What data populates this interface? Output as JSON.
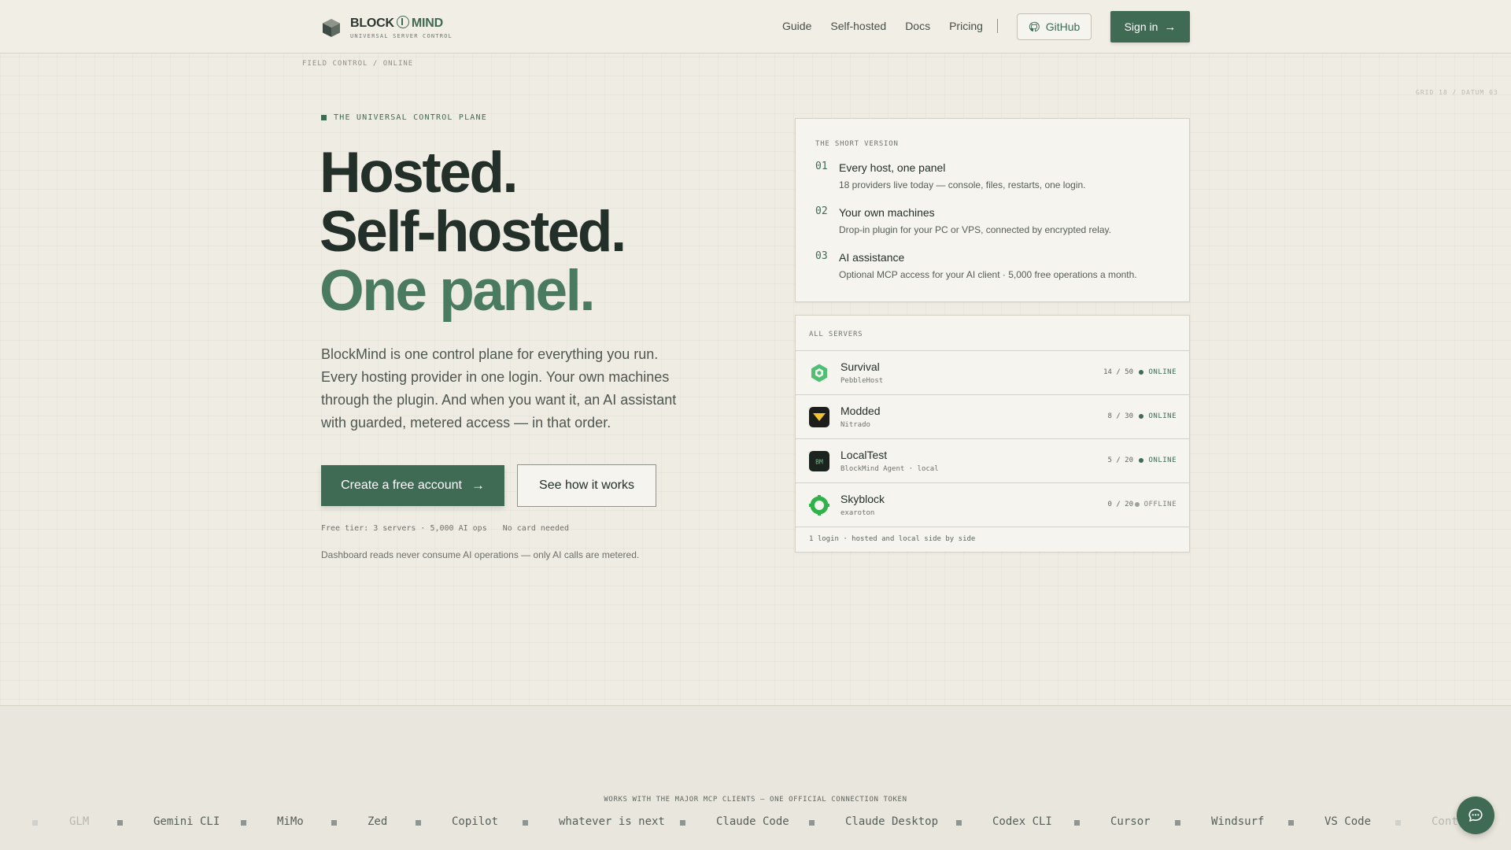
{
  "brand": {
    "name_part1": "BLOCK",
    "name_part2": "MIND",
    "tagline": "UNIVERSAL SERVER CONTROL"
  },
  "nav": {
    "links": [
      "Guide",
      "Self-hosted",
      "Docs",
      "Pricing"
    ],
    "github_label": "GitHub",
    "signin_label": "Sign in"
  },
  "meta": {
    "field_control": "FIELD CONTROL / ONLINE",
    "grid_datum": "GRID 18 / DATUM 03"
  },
  "hero": {
    "eyebrow": "THE UNIVERSAL CONTROL PLANE",
    "headline_line1": "Hosted.",
    "headline_line2": "Self-hosted.",
    "headline_line3": "One panel.",
    "lede": "BlockMind is one control plane for everything you run. Every hosting provider in one login. Your own machines through the plugin. And when you want it, an AI assistant with guarded, metered access — in that order.",
    "cta_primary": "Create a free account",
    "cta_secondary": "See how it works",
    "free_tier": "Free tier: 3 servers · 5,000 AI ops",
    "no_card": "No card needed",
    "note": "Dashboard reads never consume AI operations — only AI calls are metered."
  },
  "short_version": {
    "label": "THE SHORT VERSION",
    "items": [
      {
        "num": "01",
        "title": "Every host, one panel",
        "desc": "18 providers live today — console, files, restarts, one login."
      },
      {
        "num": "02",
        "title": "Your own machines",
        "desc": "Drop-in plugin for your PC or VPS, connected by encrypted relay."
      },
      {
        "num": "03",
        "title": "AI assistance",
        "desc": "Optional MCP access for your AI client · 5,000 free operations a month."
      }
    ]
  },
  "servers": {
    "label": "ALL SERVERS",
    "rows": [
      {
        "name": "Survival",
        "host": "PebbleHost",
        "count": "14 / 50",
        "status": "ONLINE",
        "icon": "pebblehost-icon"
      },
      {
        "name": "Modded",
        "host": "Nitrado",
        "count": "8 / 30",
        "status": "ONLINE",
        "icon": "nitrado-icon"
      },
      {
        "name": "LocalTest",
        "host": "BlockMind Agent · local",
        "count": "5 / 20",
        "status": "ONLINE",
        "icon": "blockmind-agent-icon",
        "icon_text": "BM"
      },
      {
        "name": "Skyblock",
        "host": "exaroton",
        "count": "0 / 20",
        "status": "OFFLINE",
        "icon": "exaroton-icon"
      }
    ],
    "footer": "1 login · hosted and local side by side"
  },
  "clients": {
    "label": "WORKS WITH THE MAJOR MCP CLIENTS — ONE OFFICIAL CONNECTION TOKEN",
    "items": [
      "GLM",
      "Gemini CLI",
      "MiMo",
      "Zed",
      "Copilot",
      "whatever is next",
      "Claude Code",
      "Claude Desktop",
      "Codex CLI",
      "Cursor",
      "Windsurf",
      "VS Code",
      "Conti"
    ]
  },
  "colors": {
    "accent": "#3f6b55",
    "background": "#efece3",
    "card": "#f6f4ee"
  }
}
